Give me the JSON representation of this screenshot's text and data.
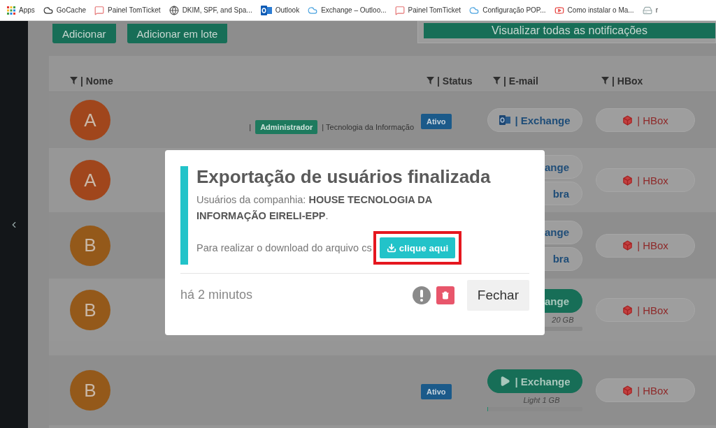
{
  "bookmarks": [
    {
      "kind": "apps",
      "label": "Apps"
    },
    {
      "kind": "cloud",
      "label": "GoCache"
    },
    {
      "kind": "chat",
      "label": "Painel TomTicket"
    },
    {
      "kind": "globe",
      "label": "DKIM, SPF, and Spa..."
    },
    {
      "kind": "outlook",
      "label": "Outlook"
    },
    {
      "kind": "azure",
      "label": "Exchange – Outloo..."
    },
    {
      "kind": "chat",
      "label": "Painel TomTicket"
    },
    {
      "kind": "azure",
      "label": "Configuração POP..."
    },
    {
      "kind": "youtube",
      "label": "Como instalar o Ma..."
    },
    {
      "kind": "drive",
      "label": "r"
    }
  ],
  "actions": [
    "Adicionar",
    "Adicionar em lote"
  ],
  "notifications_button": "Visualizar todas as notificações",
  "table": {
    "columns": [
      {
        "label": "| Nome"
      },
      {
        "label": "| Status"
      },
      {
        "label": "| E-mail"
      },
      {
        "label": "| HBox"
      }
    ],
    "rows": [
      {
        "initial": "A",
        "color": "#a0461c",
        "lead": "|",
        "role": "Administrador",
        "department": "| Tecnologia da Informação",
        "status": "Ativo",
        "email": [
          {
            "kind": "outlook",
            "label": "| Exchange"
          }
        ],
        "hbox": "| HBox"
      },
      {
        "initial": "A",
        "color": "#a0461c",
        "email": [
          {
            "kind": "cut",
            "label": "ange"
          },
          {
            "kind": "cut",
            "label": "bra"
          }
        ],
        "hbox": "| HBox"
      },
      {
        "initial": "B",
        "color": "#94591a",
        "email": [
          {
            "kind": "cut",
            "label": "ange"
          },
          {
            "kind": "cut",
            "label": "bra"
          }
        ],
        "hbox": "| HBox"
      },
      {
        "initial": "B",
        "color": "#94591a",
        "email": [
          {
            "kind": "cut-green",
            "label": "ange"
          }
        ],
        "plan": "20 GB",
        "hbox": "| HBox"
      },
      {
        "initial": "B",
        "color": "#94591a",
        "status": "Ativo",
        "email": [
          {
            "kind": "play",
            "label": "| Exchange"
          }
        ],
        "plan": "Light 1 GB",
        "level": 0.01,
        "hbox": "| HBox"
      }
    ]
  },
  "modal": {
    "title": "Exportação de usuários finalizada",
    "company": "Usuários da companhia: **HOUSE TECNOLOGIA DA INFORMAÇÃO EIRELI-EPP**.",
    "download_text": "Para realizar o download do arquivo cs",
    "download_button": "clique aqui",
    "highlighted": true,
    "time": "há 2 minutos",
    "close_button": "Fechar"
  }
}
